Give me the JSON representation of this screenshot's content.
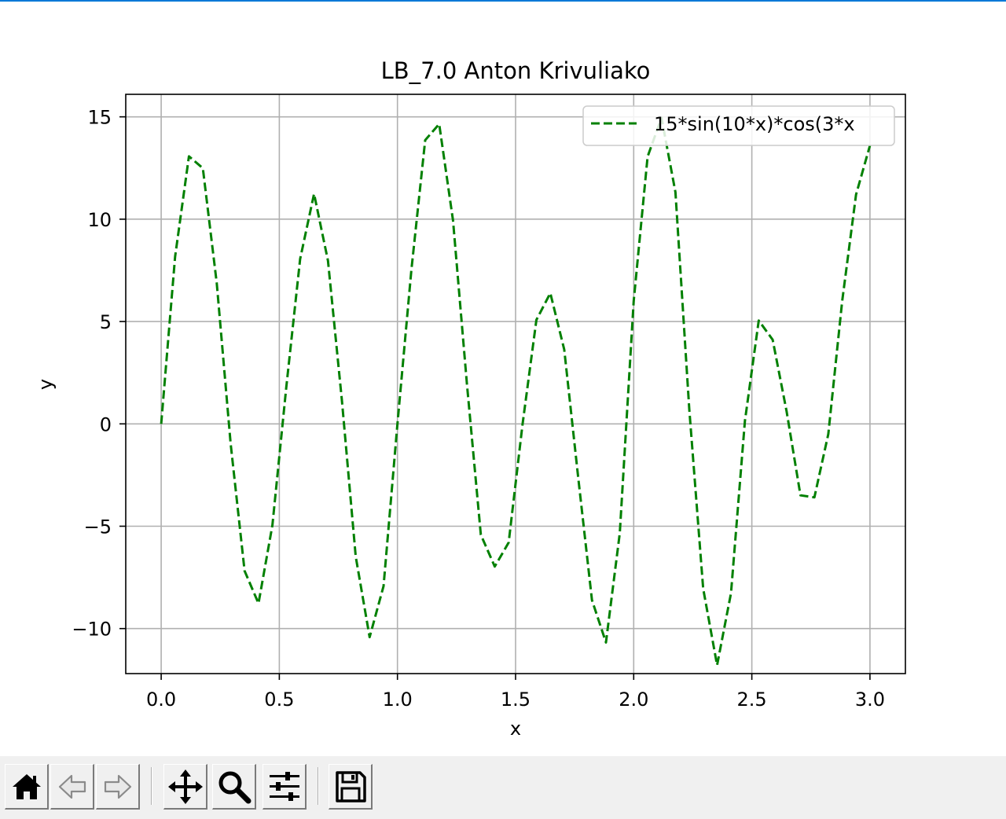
{
  "chart_data": {
    "type": "line",
    "title": "LB_7.0 Anton Krivuliako",
    "xlabel": "x",
    "ylabel": "y",
    "xlim": [
      -0.15,
      3.15
    ],
    "ylim": [
      -12.2,
      16.1
    ],
    "x_ticks": [
      0.0,
      0.5,
      1.0,
      1.5,
      2.0,
      2.5,
      3.0
    ],
    "x_tick_labels": [
      "0.0",
      "0.5",
      "1.0",
      "1.5",
      "2.0",
      "2.5",
      "3.0"
    ],
    "y_ticks": [
      -10,
      -5,
      0,
      5,
      10,
      15
    ],
    "y_tick_labels": [
      "−10",
      "−5",
      "0",
      "5",
      "10",
      "15"
    ],
    "grid": true,
    "legend_position": "upper-right",
    "series": [
      {
        "name": "15*sin(10*x)*cos(3*x",
        "color": "#008000",
        "line_style": "dashed",
        "x": [
          0.0,
          0.0588,
          0.1176,
          0.1765,
          0.2353,
          0.2941,
          0.3529,
          0.4118,
          0.4706,
          0.5294,
          0.5882,
          0.6471,
          0.7059,
          0.7647,
          0.8235,
          0.8824,
          0.9412,
          1.0,
          1.0588,
          1.1176,
          1.1765,
          1.2353,
          1.2941,
          1.3529,
          1.4118,
          1.4706,
          1.5294,
          1.5882,
          1.6471,
          1.7059,
          1.7647,
          1.8235,
          1.8824,
          1.9412,
          2.0,
          2.0588,
          2.1176,
          2.1765,
          2.2353,
          2.2941,
          2.3529,
          2.4118,
          2.4706,
          2.5294,
          2.5882,
          2.6471,
          2.7059,
          2.7647,
          2.8235,
          2.8824,
          2.9412,
          3.0
        ],
        "y": [
          0.0,
          8.17,
          13.07,
          12.49,
          6.87,
          -0.98,
          -7.18,
          -8.77,
          -4.95,
          1.77,
          8.06,
          11.24,
          7.97,
          1.16,
          -6.48,
          -10.42,
          -7.93,
          0.0,
          7.51,
          13.86,
          14.65,
          9.94,
          1.95,
          -5.42,
          -6.97,
          -5.8,
          -0.04,
          5.08,
          6.39,
          3.63,
          -2.59,
          -8.61,
          -10.68,
          -5.34,
          6.0,
          13.06,
          14.95,
          11.32,
          0.72,
          -8.05,
          -11.79,
          -8.27,
          0.14,
          5.05,
          4.11,
          0.62,
          -3.49,
          -3.59,
          -0.5,
          6.01,
          11.2,
          13.6
        ]
      }
    ]
  },
  "toolbar": {
    "buttons": [
      {
        "icon": "home-icon",
        "name": "home-button"
      },
      {
        "icon": "arrow-left-icon",
        "name": "back-button"
      },
      {
        "icon": "arrow-right-icon",
        "name": "forward-button"
      },
      {
        "icon": "pan-icon",
        "name": "pan-button"
      },
      {
        "icon": "zoom-icon",
        "name": "zoom-button"
      },
      {
        "icon": "sliders-icon",
        "name": "configure-subplots-button"
      },
      {
        "icon": "save-icon",
        "name": "save-button"
      }
    ]
  }
}
